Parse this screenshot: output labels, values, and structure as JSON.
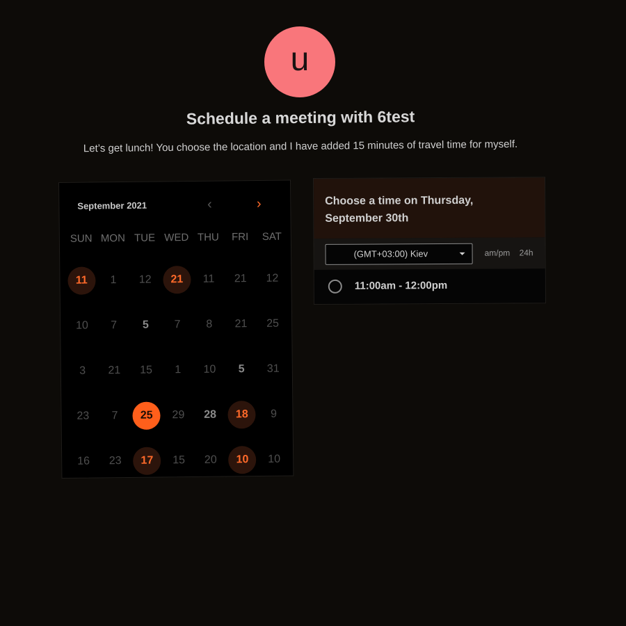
{
  "host": {
    "avatar_letter": "u",
    "avatar_color": "#f9767b"
  },
  "header": {
    "title": "Schedule a meeting with 6test",
    "description": "Let’s get lunch! You choose the location and I have added 15 minutes of travel time for myself."
  },
  "calendar": {
    "month_label": "September 2021",
    "prev_icon": "chevron-left-icon",
    "next_icon": "chevron-right-icon",
    "weekdays": [
      "SUN",
      "MON",
      "TUE",
      "WED",
      "THU",
      "FRI",
      "SAT"
    ],
    "accent_color": "#ff5f1b",
    "days": [
      {
        "label": "11",
        "state": "available"
      },
      {
        "label": "1",
        "state": "disabled"
      },
      {
        "label": "12",
        "state": "disabled"
      },
      {
        "label": "21",
        "state": "available"
      },
      {
        "label": "11",
        "state": "disabled"
      },
      {
        "label": "21",
        "state": "disabled"
      },
      {
        "label": "12",
        "state": "disabled"
      },
      {
        "label": "10",
        "state": "disabled"
      },
      {
        "label": "7",
        "state": "disabled"
      },
      {
        "label": "5",
        "state": "bold"
      },
      {
        "label": "7",
        "state": "disabled"
      },
      {
        "label": "8",
        "state": "disabled"
      },
      {
        "label": "21",
        "state": "disabled"
      },
      {
        "label": "25",
        "state": "disabled"
      },
      {
        "label": "3",
        "state": "disabled"
      },
      {
        "label": "21",
        "state": "disabled"
      },
      {
        "label": "15",
        "state": "disabled"
      },
      {
        "label": "1",
        "state": "disabled"
      },
      {
        "label": "10",
        "state": "disabled"
      },
      {
        "label": "5",
        "state": "bold"
      },
      {
        "label": "31",
        "state": "disabled"
      },
      {
        "label": "23",
        "state": "disabled"
      },
      {
        "label": "7",
        "state": "disabled"
      },
      {
        "label": "25",
        "state": "selected"
      },
      {
        "label": "29",
        "state": "disabled"
      },
      {
        "label": "28",
        "state": "bold"
      },
      {
        "label": "18",
        "state": "available"
      },
      {
        "label": "9",
        "state": "disabled"
      },
      {
        "label": "16",
        "state": "disabled"
      },
      {
        "label": "23",
        "state": "disabled"
      },
      {
        "label": "17",
        "state": "available"
      },
      {
        "label": "15",
        "state": "disabled"
      },
      {
        "label": "20",
        "state": "disabled"
      },
      {
        "label": "10",
        "state": "available"
      },
      {
        "label": "10",
        "state": "disabled"
      }
    ]
  },
  "times": {
    "title": "Choose a time on Thursday, September 30th",
    "timezone_value": "(GMT+03:00) Kiev",
    "format_ampm": "am/pm",
    "format_24h": "24h",
    "slots": [
      {
        "label": "11:00am - 12:00pm"
      }
    ]
  }
}
